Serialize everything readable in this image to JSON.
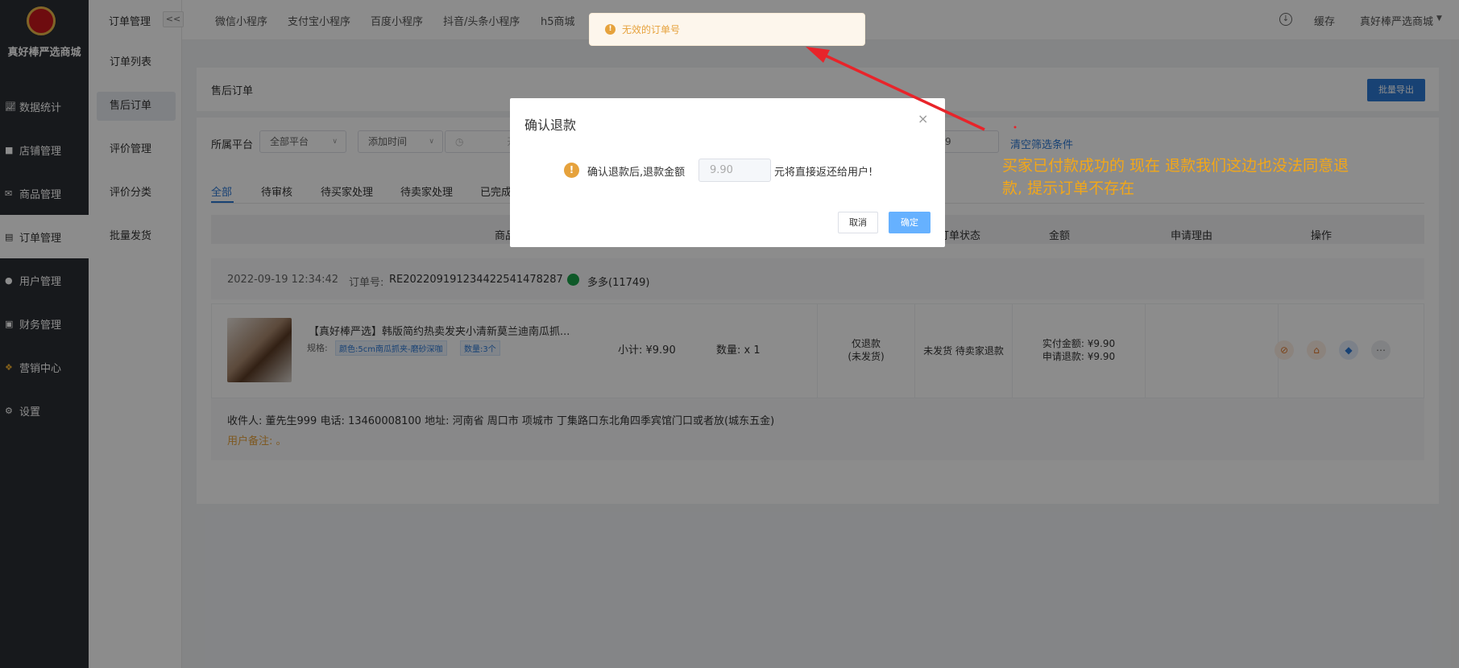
{
  "sidebar": {
    "brand": "真好棒严选商城",
    "items": [
      {
        "label": "数据统计",
        "icon": "chart-icon"
      },
      {
        "label": "店铺管理",
        "icon": "store-icon"
      },
      {
        "label": "商品管理",
        "icon": "goods-icon"
      },
      {
        "label": "订单管理",
        "icon": "order-icon"
      },
      {
        "label": "用户管理",
        "icon": "user-icon"
      },
      {
        "label": "财务管理",
        "icon": "finance-icon"
      },
      {
        "label": "营销中心",
        "icon": "marketing-icon"
      },
      {
        "label": "设置",
        "icon": "settings-icon"
      }
    ]
  },
  "subnav": {
    "title": "订单管理",
    "items": [
      "订单列表",
      "售后订单",
      "评价管理",
      "评价分类",
      "批量发货"
    ]
  },
  "topbar": {
    "collapse": "<<",
    "tabs": [
      "微信小程序",
      "支付宝小程序",
      "百度小程序",
      "抖音/头条小程序",
      "h5商城"
    ],
    "cache": "缓存",
    "store": "真好棒严选商城"
  },
  "page": {
    "title": "售后订单",
    "export_btn": "批量导出"
  },
  "filters": {
    "platform_label": "所属平台",
    "platform_value": "全部平台",
    "time_type": "添加时间",
    "date_start": "开",
    "search_tail": "9",
    "clear_link": "清空筛选条件"
  },
  "status_tabs": [
    "全部",
    "待审核",
    "待买家处理",
    "待卖家处理",
    "已完成"
  ],
  "table": {
    "headers": [
      "商品",
      "订单状态",
      "金额",
      "申请理由",
      "操作"
    ]
  },
  "order": {
    "time": "2022-09-19 12:34:42",
    "order_no_label": "订单号:",
    "order_no": "RE20220919123442254147828",
    "order_no_tail": "7",
    "user": "多多(11749)",
    "product_title": "【真好棒严选】韩版简约热卖发夹小清新莫兰迪南瓜抓...",
    "spec_label": "规格:",
    "spec_tag": "颜色:5cm南瓜抓夹-磨砂深咖",
    "qty_tag": "数量:3个",
    "subtotal": "小计: ¥9.90",
    "quantity": "数量: x 1",
    "refund_type": "仅退款",
    "refund_sub": "(未发货)",
    "status": "未发货 待卖家退款",
    "paid": "实付金额: ¥9.90",
    "apply": "申请退款: ¥9.90",
    "address": "收件人: 董先生999 电话: 13460008100 地址: 河南省 周口市 项城市 丁集路口东北角四季宾馆门口或者放(城东五金)",
    "remark": "用户备注: 。"
  },
  "dialog": {
    "title": "确认退款",
    "text_before": "确认退款后,退款金额",
    "amount": "9.90",
    "text_after": "元将直接返还给用户!",
    "cancel": "取消",
    "ok": "确定"
  },
  "toast": {
    "message": "无效的订单号"
  },
  "annotation": {
    "text": "买家已付款成功的 现在 退款我们这边也没法同意退款, 提示订单不存在"
  },
  "colors": {
    "primary": "#2d78d4",
    "annotation": "#f3a718",
    "arrow": "#e8242a",
    "warning": "#e6a23c"
  }
}
